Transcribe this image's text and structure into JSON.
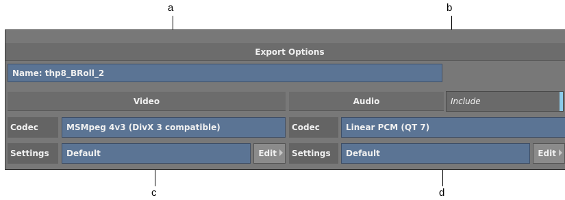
{
  "callouts": {
    "a": "a",
    "b": "b",
    "c": "c",
    "d": "d"
  },
  "panel": {
    "title": "Export Options",
    "name_field": "Name: thp8_BRoll_2"
  },
  "video": {
    "header": "Video",
    "codec_label": "Codec",
    "codec_value": "MSMpeg 4v3 (DivX 3 compatible)",
    "settings_label": "Settings",
    "settings_value": "Default",
    "edit_label": "Edit"
  },
  "audio": {
    "header": "Audio",
    "include_label": "Include",
    "codec_label": "Codec",
    "codec_value": "Linear PCM (QT 7)",
    "settings_label": "Settings",
    "settings_value": "Default",
    "edit_label": "Edit"
  },
  "colors": {
    "field_blue": "#5b7494",
    "panel_gray": "#787878",
    "include_indicator": "#8ccbea"
  }
}
